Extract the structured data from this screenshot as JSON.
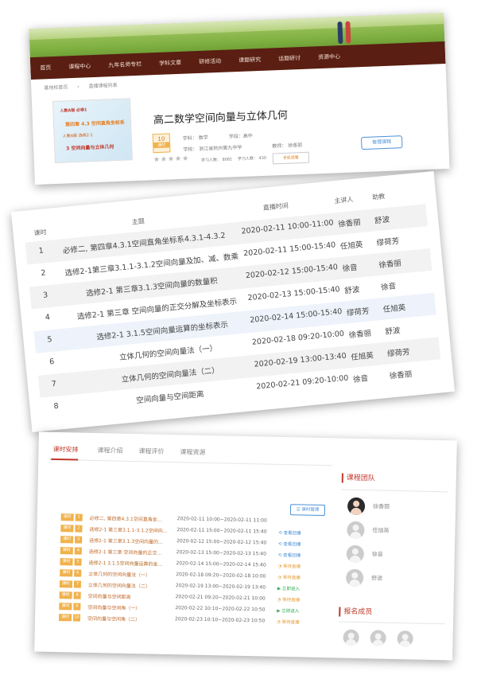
{
  "header": {
    "nav": [
      "首页",
      "课程中心",
      "九年名师专栏",
      "学科文章",
      "研修活动",
      "课题研究",
      "话题研讨",
      "资源中心"
    ],
    "breadcrumb": [
      "基地校首页",
      "直播课程列表"
    ]
  },
  "course": {
    "cover": {
      "line1": "人教A版  必修1",
      "line2": "第四章 4.3 空间直角坐标系",
      "line3": "人教A版  选修2-1",
      "line4": "3 空间向量与立体几何"
    },
    "title": "高二数学空间向量与立体几何",
    "lesson_count": "10",
    "lesson_unit": "课时",
    "subject": "学科：  数学",
    "stage": "学段：高中",
    "school": "学校：  浙江省杭州第九中学",
    "teacher": "教师：  徐香丽",
    "learners": "学习人数：  8081",
    "study_count": "学习人数：  430",
    "favorite": "手机观看",
    "stars": "★★★★★",
    "manage_button": "管理课程"
  },
  "schedule": {
    "headers": {
      "lesson": "课时",
      "topic": "主题",
      "time": "直播时间",
      "speaker": "主讲人",
      "assistant": "助教"
    },
    "rows": [
      {
        "n": "1",
        "topic": "必修二, 第四章4.3.1空间直角坐标系4.3.1-4.3.2",
        "time": "2020-02-11 10:00-11:00",
        "speaker": "徐香丽",
        "assistant": "舒波"
      },
      {
        "n": "2",
        "topic": "选修2-1第三章3.1.1-3.1.2空间向量及加、减、数乘",
        "time": "2020-02-11 15:00-15:40",
        "speaker": "任旭英",
        "assistant": "缪荷芳"
      },
      {
        "n": "3",
        "topic": "选修2-1 第三章3.1.3空间向量的数量积",
        "time": "2020-02-12 15:00-15:40",
        "speaker": "徐音",
        "assistant": "徐香丽"
      },
      {
        "n": "4",
        "topic": "选修2-1 第三章 空间向量的正交分解及坐标表示",
        "time": "2020-02-13 15:00-15:40",
        "speaker": "舒波",
        "assistant": "徐音"
      },
      {
        "n": "5",
        "topic": "选修2-1 3.1.5空间向量运算的坐标表示",
        "time": "2020-02-14 15:00-15:40",
        "speaker": "缪荷芳",
        "assistant": "任旭英"
      },
      {
        "n": "6",
        "topic": "立体几何的空间向量法（一）",
        "time": "2020-02-18 09:20-10:00",
        "speaker": "徐香丽",
        "assistant": "舒波"
      },
      {
        "n": "7",
        "topic": "立体几何的空间向量法（二）",
        "time": "2020-02-19 13:00-13:40",
        "speaker": "任旭英",
        "assistant": "缪荷芳"
      },
      {
        "n": "8",
        "topic": "空间向量与空间距离",
        "time": "2020-02-21 09:20-10:00",
        "speaker": "徐音",
        "assistant": "徐香丽"
      }
    ]
  },
  "detail": {
    "tabs": [
      "课时安排",
      "课程介绍",
      "课程评价",
      "课程资源"
    ],
    "manage_lessons": "课时管理",
    "lesson_tag": "课时",
    "lessons": [
      {
        "n": "1",
        "title": "必修二, 第四章4.3.1空间直角坐...",
        "time": "2020-02-11 10:00~2020-02-11 11:00",
        "status": "",
        "status_type": "none"
      },
      {
        "n": "2",
        "title": "选修2-1 第三章3.1.1-3.1.2空间向...",
        "time": "2020-02-11 15:00~2020-02-11 15:40",
        "status": "查看回播",
        "status_type": "blue"
      },
      {
        "n": "3",
        "title": "选修2-1 第三章3.1.3空间向量的...",
        "time": "2020-02-12 15:00~2020-02-12 15:40",
        "status": "查看回播",
        "status_type": "blue"
      },
      {
        "n": "4",
        "title": "选修2-1 第三章 空间向量的正交...",
        "time": "2020-02-13 15:00~2020-02-13 15:40",
        "status": "查看回播",
        "status_type": "blue"
      },
      {
        "n": "5",
        "title": "选修2-1 3.1.5空间向量运算的坐...",
        "time": "2020-02-14 15:00~2020-02-14 15:40",
        "status": "等待直播",
        "status_type": "orange"
      },
      {
        "n": "6",
        "title": "立体几何的空间向量法（一）",
        "time": "2020-02-18 09:20~2020-02-18 10:00",
        "status": "等待直播",
        "status_type": "orange"
      },
      {
        "n": "7",
        "title": "立体几何的空间向量法（二）",
        "time": "2020-02-19 13:00~2020-02-19 13:40",
        "status": "立即进入",
        "status_type": "green"
      },
      {
        "n": "8",
        "title": "空间向量与空间距离",
        "time": "2020-02-21 09:20~2020-02-21 10:00",
        "status": "等待直播",
        "status_type": "orange"
      },
      {
        "n": "9",
        "title": "空间向量与空间角（一）",
        "time": "2020-02-22 10:10~2020-02-22 10:50",
        "status": "立即进入",
        "status_type": "green"
      },
      {
        "n": "10",
        "title": "空间向量与空间角（二）",
        "time": "2020-02-23 10:10~2020-02-23 10:50",
        "status": "等待直播",
        "status_type": "orange"
      }
    ],
    "team_title": "课程团队",
    "team": [
      "徐香丽",
      "任旭英",
      "徐音",
      "舒波"
    ],
    "members_title": "报名成员"
  }
}
